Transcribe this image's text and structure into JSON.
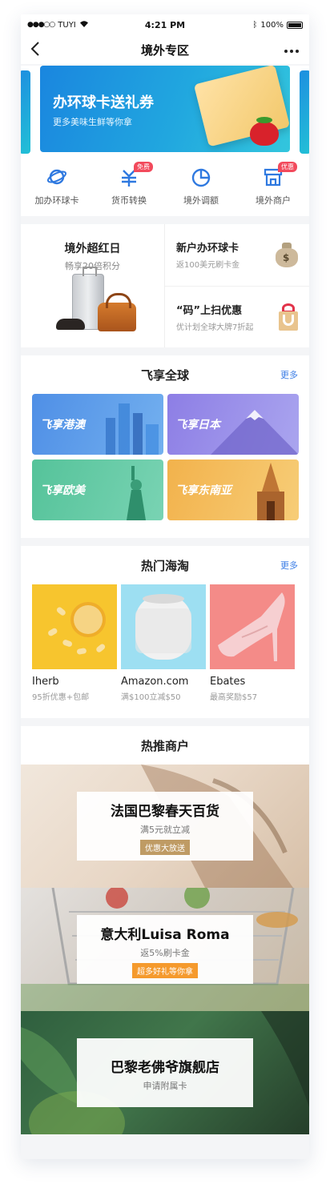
{
  "status": {
    "carrier": "TUYI",
    "time": "4:21 PM",
    "battery": "100%"
  },
  "nav": {
    "title": "境外专区",
    "back_icon": "chevron-left-icon",
    "more_icon": "more-icon"
  },
  "banner": {
    "title": "办环球卡送礼券",
    "subtitle": "更多美味生鲜等你拿"
  },
  "quick_icons": [
    {
      "label": "加办环球卡",
      "icon": "planet-icon",
      "tag": ""
    },
    {
      "label": "货币转换",
      "icon": "currency-exchange-icon",
      "tag": "免费"
    },
    {
      "label": "境外调额",
      "icon": "pie-chart-icon",
      "tag": ""
    },
    {
      "label": "境外商户",
      "icon": "shop-icon",
      "tag": "优惠"
    }
  ],
  "promo": {
    "left": {
      "title": "境外超红日",
      "subtitle": "畅享20倍积分"
    },
    "right": [
      {
        "title": "新户办环球卡",
        "subtitle": "返100美元刷卡金",
        "icon": "money-bag-icon"
      },
      {
        "title": "“码”上扫优惠",
        "subtitle": "优计划全球大牌7折起",
        "icon": "gift-bag-icon"
      }
    ]
  },
  "fly": {
    "title": "飞享全球",
    "more": "更多",
    "items": [
      {
        "label": "飞享港澳",
        "color": "#4f8fe6"
      },
      {
        "label": "飞享日本",
        "color": "#8d7ee5"
      },
      {
        "label": "飞享欧美",
        "color": "#55c39a"
      },
      {
        "label": "飞享东南亚",
        "color": "#f2b24c"
      }
    ]
  },
  "hot": {
    "title": "热门海淘",
    "more": "更多",
    "items": [
      {
        "name": "Iherb",
        "sub": "95折优惠+包邮"
      },
      {
        "name": "Amazon.com",
        "sub": "满$100立减$50"
      },
      {
        "name": "Ebates",
        "sub": "最高奖励$57"
      }
    ]
  },
  "merchants": {
    "title": "热推商户",
    "items": [
      {
        "title": "法国巴黎春天百货",
        "subtitle": "满5元就立减",
        "tag": "优惠大放送"
      },
      {
        "title": "意大利Luisa Roma",
        "subtitle": "返5%刷卡金",
        "tag": "超多好礼等你拿"
      },
      {
        "title": "巴黎老佛爷旗舰店",
        "subtitle": "申请附属卡",
        "tag": ""
      }
    ]
  }
}
